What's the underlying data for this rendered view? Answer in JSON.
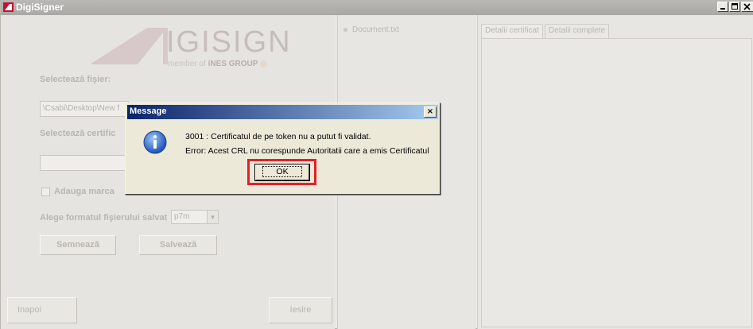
{
  "window": {
    "title": "DigiSigner",
    "buttons": {
      "minimize": "_",
      "maximize": "□",
      "close": "×"
    }
  },
  "logo": {
    "brand": "IGISIGN",
    "tagline_prefix": "member of ",
    "tagline_brand": "iNES GROUP"
  },
  "left": {
    "select_file_label": "Selectează fişier:",
    "file_path": "\\Csabi\\Desktop\\New f",
    "select_cert_label": "Selectează certific",
    "cert_value": "",
    "watermark_label": "Adauga marca",
    "format_label": "Alege formatul fişierului salvat",
    "format_value": "p7m",
    "sign_button": "Semnează",
    "save_button": "Salvează",
    "back_button": "Inapoi",
    "exit_button": "Iesire"
  },
  "middle": {
    "document_name": "Document.txt"
  },
  "right": {
    "tabs": [
      "Detalii certificat",
      "Detalii complete"
    ]
  },
  "dialog": {
    "title": "Message",
    "message_line1": "3001 : Certificatul de pe token nu a putut fi validat.",
    "message_line2": "Error: Acest CRL nu corespunde Autoritatii care a emis Certificatul",
    "ok_label": "OK",
    "close_glyph": "×",
    "highlight_color": "#e3202a"
  }
}
